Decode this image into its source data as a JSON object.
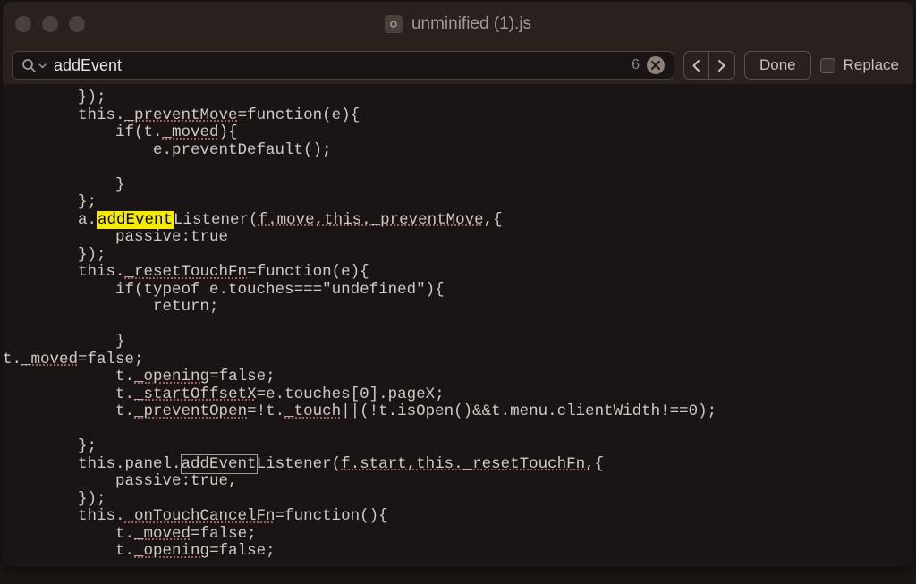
{
  "window": {
    "title": "unminified (1).js"
  },
  "findbar": {
    "query": "addEvent",
    "result_count": "6",
    "done_label": "Done",
    "replace_label": "Replace"
  },
  "code": {
    "indent3": "            ",
    "indent2": "        ",
    "l1": "});",
    "l2_a": "this.",
    "l2_b": "_preventMove",
    "l2_c": "=function(e){",
    "l3_a": "if(t.",
    "l3_b": "_moved",
    "l3_c": "){",
    "l4": "e.preventDefault();",
    "l5": "",
    "l6": "}",
    "l7": "};",
    "l8_a": "a.",
    "l8_hl": "addEvent",
    "l8_b": "Listener(",
    "l8_c": "f.move,this._preventMove",
    "l8_d": ",{",
    "l9": "passive:true",
    "l10": "});",
    "l11_a": "this.",
    "l11_b": "_resetTouchFn",
    "l11_c": "=function(e){",
    "l12": "if(typeof e.touches===\"undefined\"){",
    "l13": "return;",
    "l14": "",
    "l15": "}",
    "l16_a": "t.",
    "l16_b": "_moved",
    "l16_c": "=false;",
    "l17_a": "t.",
    "l17_b": "_opening",
    "l17_c": "=false;",
    "l18_a": "t.",
    "l18_b": "_startOffsetX",
    "l18_c": "=e.touches[0].pageX;",
    "l19_a": "t.",
    "l19_b": "_preventOpen",
    "l19_c": "=!t.",
    "l19_d": "_touch",
    "l19_e": "||(!t.isOpen()&&t.menu.clientWidth!==0);",
    "l20": "",
    "l21": "};",
    "l22_a": "this.panel.",
    "l22_hl": "addEvent",
    "l22_b": "Listener(",
    "l22_c": "f.start,this._resetTouchFn",
    "l22_d": ",{",
    "l23": "passive:true,",
    "l24": "});",
    "l25_a": "this.",
    "l25_b": "_onTouchCancelFn",
    "l25_c": "=function(){",
    "l26_a": "t.",
    "l26_b": "_moved",
    "l26_c": "=false;",
    "l27_a": "t.",
    "l27_b": "_opening",
    "l27_c": "=false;"
  }
}
